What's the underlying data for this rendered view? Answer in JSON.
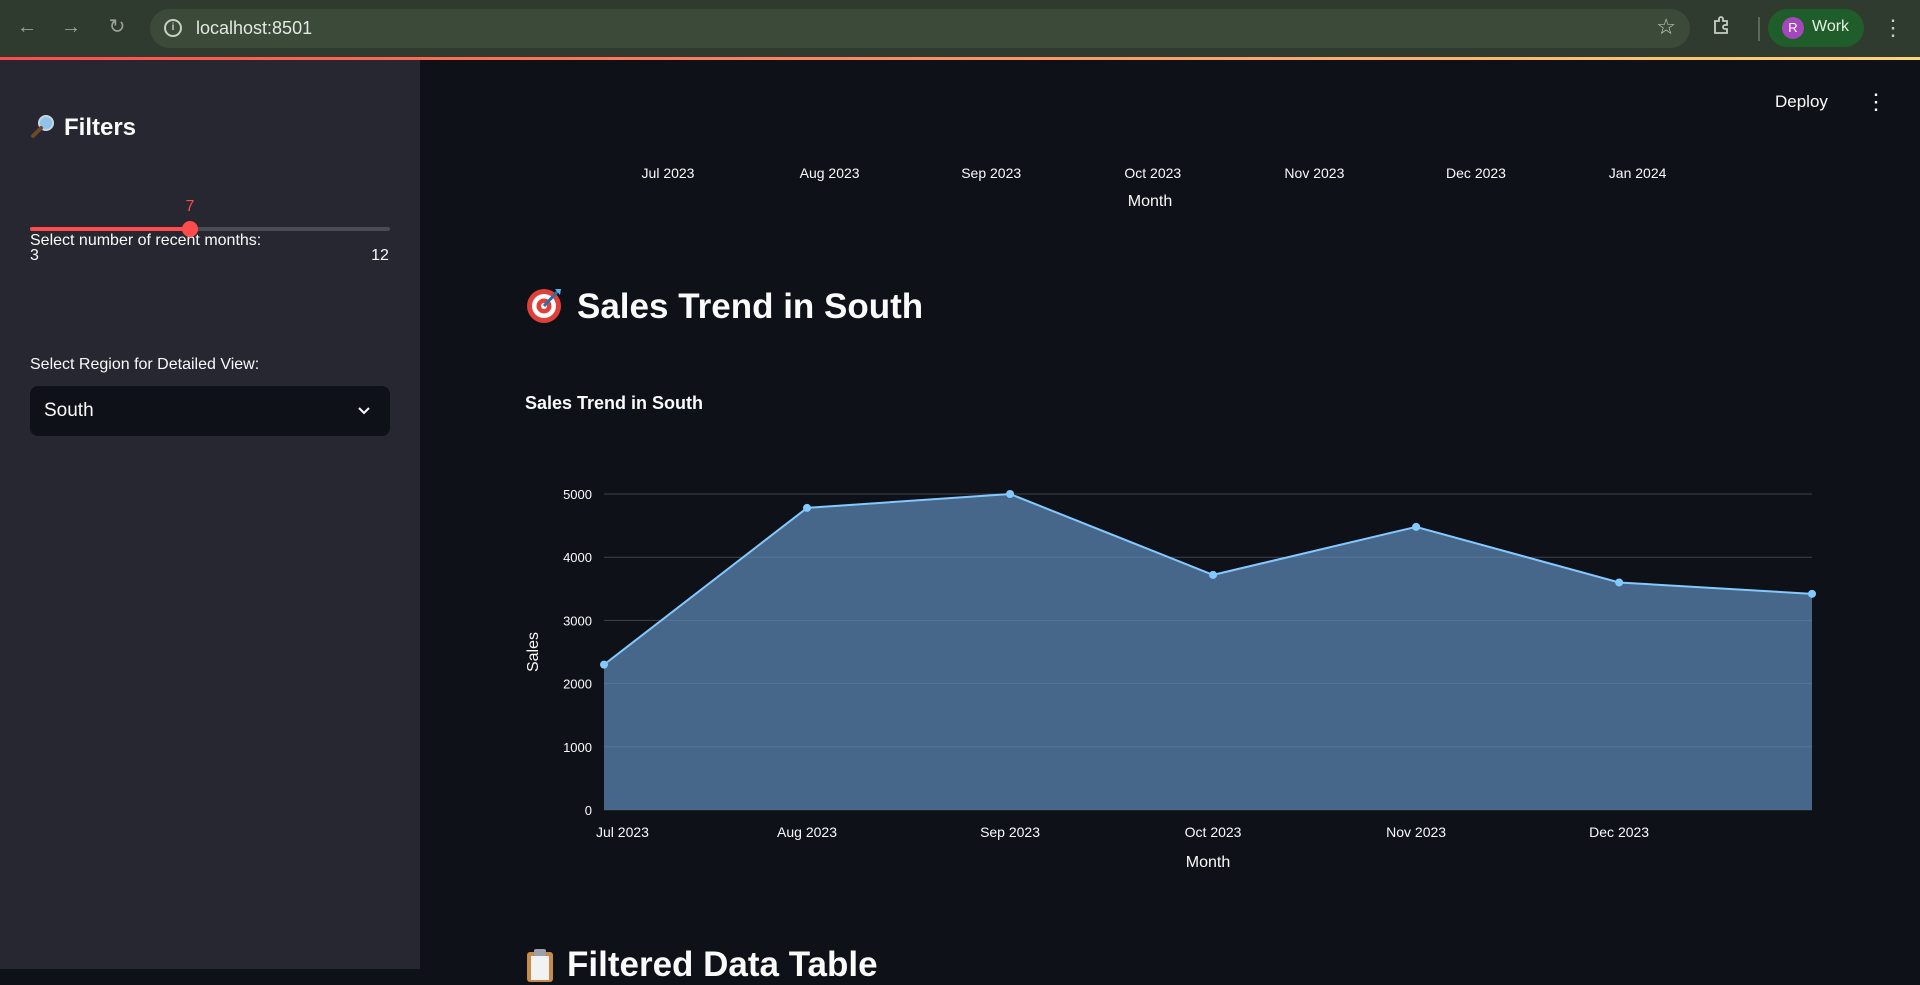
{
  "browser": {
    "url": "localhost:8501",
    "profile_initial": "R",
    "profile_label": "Work"
  },
  "sidebar": {
    "title": "Filters",
    "slider": {
      "label": "Select number of recent months:",
      "value": 7,
      "min": 3,
      "max": 12
    },
    "select": {
      "label": "Select Region for Detailed View:",
      "value": "South"
    }
  },
  "header": {
    "deploy_label": "Deploy"
  },
  "top_chart": {
    "ticks": [
      "Jul 2023",
      "Aug 2023",
      "Sep 2023",
      "Oct 2023",
      "Nov 2023",
      "Dec 2023",
      "Jan 2024"
    ],
    "xlabel": "Month"
  },
  "section_title": "Sales Trend in South",
  "chart_data": {
    "type": "area",
    "title": "Sales Trend in South",
    "xlabel": "Month",
    "ylabel": "Sales",
    "x": [
      "2023-07",
      "2023-08",
      "2023-09",
      "2023-10",
      "2023-11",
      "2023-12",
      "2024-01"
    ],
    "x_tick_labels": [
      "Jul 2023",
      "Aug 2023",
      "Sep 2023",
      "Oct 2023",
      "Nov 2023",
      "Dec 2023"
    ],
    "values": [
      2300,
      4780,
      5000,
      3720,
      4480,
      3600,
      3420
    ],
    "y_ticks": [
      0,
      1000,
      2000,
      3000,
      4000,
      5000
    ],
    "ylim": [
      0,
      5000
    ],
    "grid": true,
    "colors": {
      "line": "#83c9ff",
      "fill": "#4a6d8f"
    }
  },
  "next_section_title": "Filtered Data Table"
}
